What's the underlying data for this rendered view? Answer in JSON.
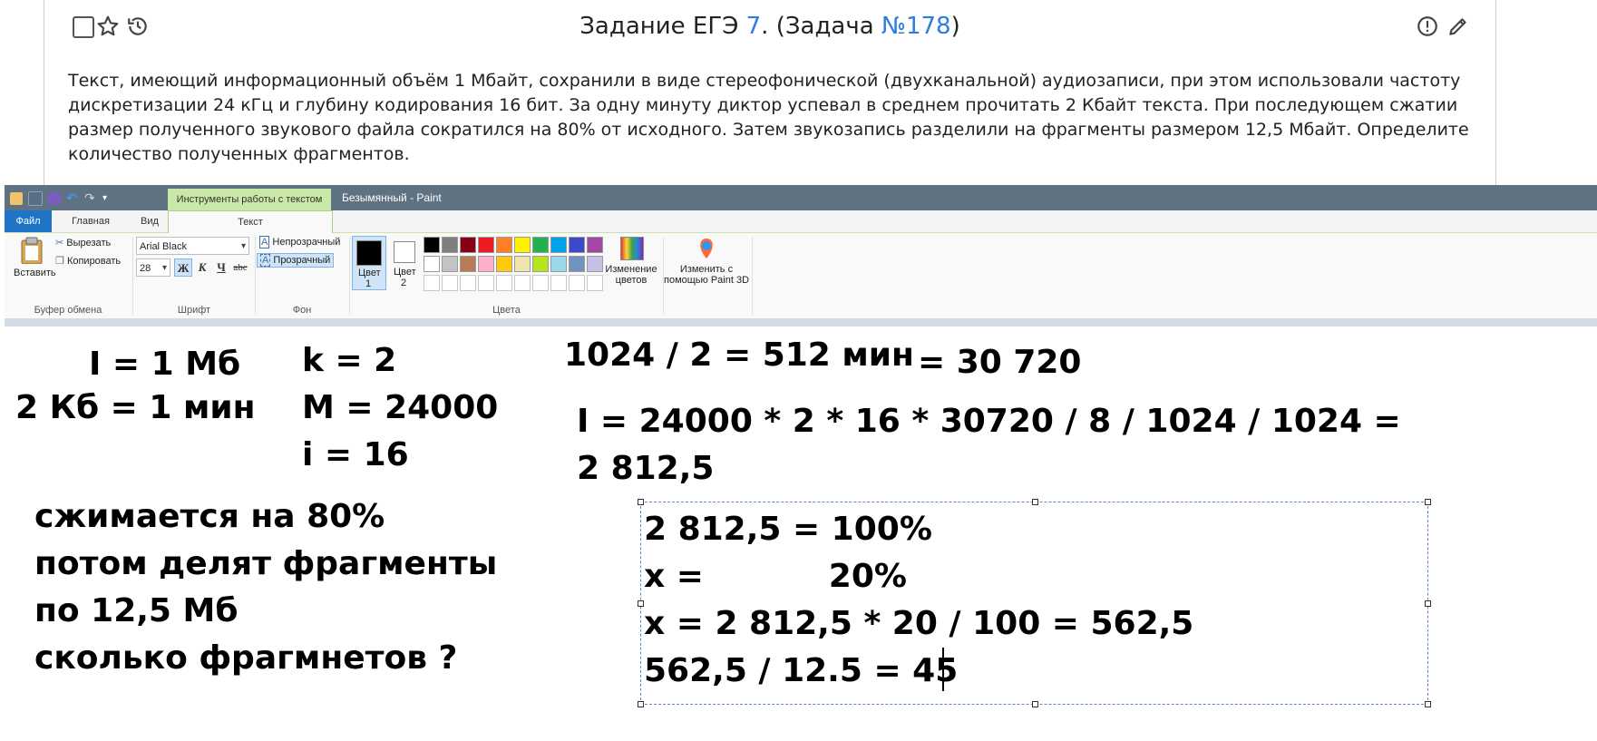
{
  "task": {
    "title_prefix": "Задание ЕГЭ ",
    "title_num": "7",
    "title_mid": ". (Задача ",
    "title_id": "№178",
    "title_end": ")",
    "text": "Текст, имеющий информационный объём 1 Мбайт, сохранили в виде стереофонической (двухканальной) аудиозаписи, при этом использовали частоту дискретизации 24 кГц и глубину кодирования 16 бит. За одну минуту диктор успевал в среднем прочитать 2 Кбайт текста. При последующем сжатии размер полученного звукового файла сократился на 80% от исходного. Затем звукозапись разделили на фрагменты размером 12,5 Мбайт. Определите количество полученных фрагментов."
  },
  "paint": {
    "context_tab": "Инструменты работы с текстом",
    "window_title": "Безымянный - Paint",
    "tabs": {
      "file": "Файл",
      "home": "Главная",
      "view": "Вид",
      "text": "Текст"
    },
    "clipboard": {
      "paste": "Вставить",
      "cut": "Вырезать",
      "copy": "Копировать",
      "group": "Буфер обмена"
    },
    "font": {
      "family": "Arial Black",
      "size": "28",
      "bold": "Ж",
      "italic": "К",
      "underline": "Ч",
      "strike": "abc",
      "group": "Шрифт"
    },
    "background": {
      "opaque": "Непрозрачный",
      "transparent": "Прозрачный",
      "group": "Фон"
    },
    "colors": {
      "color1_label": "Цвет",
      "color1_num": "1",
      "color2_label": "Цвет",
      "color2_num": "2",
      "edit_line1": "Изменение",
      "edit_line2": "цветов",
      "group": "Цвета",
      "row1": [
        "#000000",
        "#7f7f7f",
        "#880015",
        "#ed1c24",
        "#ff7f27",
        "#fff200",
        "#22b14c",
        "#00a2e8",
        "#3f48cc",
        "#a349a4"
      ],
      "row2": [
        "#ffffff",
        "#c3c3c3",
        "#b97a57",
        "#ffaec9",
        "#ffc90e",
        "#efe4b0",
        "#b5e61d",
        "#99d9ea",
        "#7092be",
        "#c8bfe7"
      ]
    },
    "paint3d": {
      "line1": "Изменить с",
      "line2": "помощью Paint 3D"
    }
  },
  "notes": {
    "given_i": "I = 1 Мб",
    "given_rate": "2 Кб = 1 мин",
    "given_k": "k = 2",
    "given_m": "M = 24000",
    "given_depth": "i = 16",
    "minutes": "1024 / 2 = 512 мин",
    "seconds": "= 30 720",
    "formula": "I = 24000 * 2 * 16 * 30720  / 8 / 1024 / 1024 =",
    "result": "2 812,5",
    "cond1": "сжимается на 80%",
    "cond2": "потом делят фрагменты",
    "cond3": "по 12,5 Мб",
    "cond4": "сколько фрагмнетов ?",
    "calc1": "2 812,5 = 100%",
    "calc2": "x =           20%",
    "calc3": "x = 2 812,5 * 20 / 100 = 562,5",
    "calc4": "562,5 / 12.5 = 45"
  }
}
